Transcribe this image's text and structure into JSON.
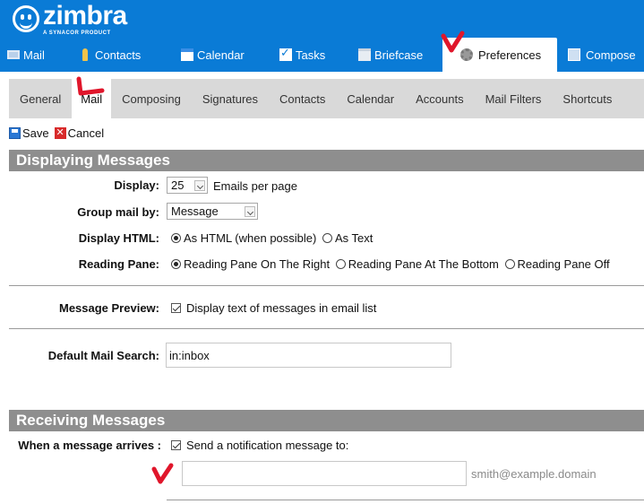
{
  "header": {
    "logo_text": "zimbra",
    "logo_sub": "A SYNACOR PRODUCT"
  },
  "app_tabs": [
    {
      "label": "Mail",
      "icon": "mail-icon"
    },
    {
      "label": "Contacts",
      "icon": "contacts-icon"
    },
    {
      "label": "Calendar",
      "icon": "calendar-icon"
    },
    {
      "label": "Tasks",
      "icon": "tasks-icon"
    },
    {
      "label": "Briefcase",
      "icon": "briefcase-icon"
    },
    {
      "label": "Preferences",
      "icon": "gear-icon",
      "active": true
    },
    {
      "label": "Compose",
      "icon": "compose-icon"
    }
  ],
  "sub_tabs": [
    {
      "label": "General"
    },
    {
      "label": "Mail",
      "active": true
    },
    {
      "label": "Composing"
    },
    {
      "label": "Signatures"
    },
    {
      "label": "Contacts"
    },
    {
      "label": "Calendar"
    },
    {
      "label": "Accounts"
    },
    {
      "label": "Mail Filters"
    },
    {
      "label": "Shortcuts"
    }
  ],
  "toolbar": {
    "save_label": "Save",
    "cancel_label": "Cancel"
  },
  "displaying": {
    "title": "Displaying Messages",
    "display_label": "Display:",
    "display_value": "25",
    "display_suffix": "Emails per page",
    "group_label": "Group mail by:",
    "group_value": "Message",
    "html_label": "Display HTML:",
    "html_options": [
      "As HTML (when possible)",
      "As Text"
    ],
    "html_selected": 0,
    "pane_label": "Reading Pane:",
    "pane_options": [
      "Reading Pane On The Right",
      "Reading Pane At The Bottom",
      "Reading Pane Off"
    ],
    "pane_selected": 0,
    "preview_label": "Message Preview:",
    "preview_text": "Display text of messages in email list",
    "preview_checked": true,
    "search_label": "Default Mail Search:",
    "search_value": "in:inbox"
  },
  "receiving": {
    "title": "Receiving Messages",
    "arrives_label": "When a message arrives :",
    "notify_text": "Send a notification message to:",
    "notify_checked": true,
    "notify_input_value": "",
    "email_hint": "smith@example.domain"
  },
  "colors": {
    "brand_blue": "#0a7bd6",
    "section_gray": "#8e8e8e",
    "annotation_red": "#e0162b"
  }
}
